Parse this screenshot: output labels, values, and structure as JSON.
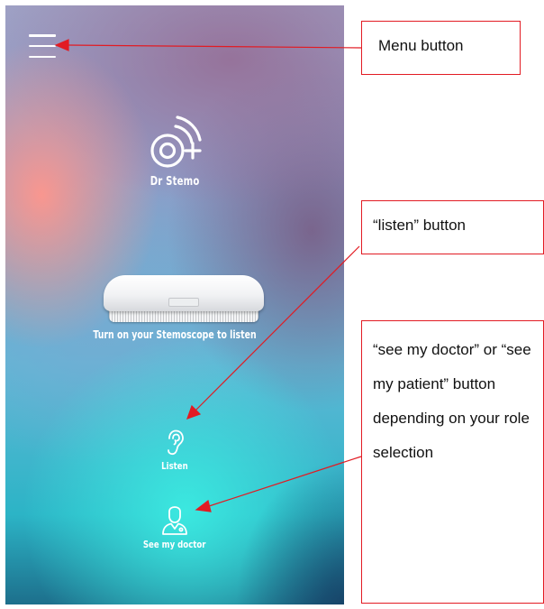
{
  "app": {
    "name": "Dr Stemo",
    "prompt": "Turn on your Stemoscope to listen"
  },
  "toolbar": {
    "menu_icon": "hamburger-menu-icon"
  },
  "actions": {
    "listen_label": "Listen",
    "listen_icon": "ear-icon",
    "doctor_label": "See my doctor",
    "doctor_icon": "doctor-person-icon"
  },
  "annotations": {
    "menu": "Menu button",
    "listen": "“listen” button",
    "see_doctor": "“see my doctor” or “see my patient” button depending on your role selection"
  },
  "colors": {
    "annotation_red": "#e21b23",
    "icon_white": "#ffffff"
  }
}
